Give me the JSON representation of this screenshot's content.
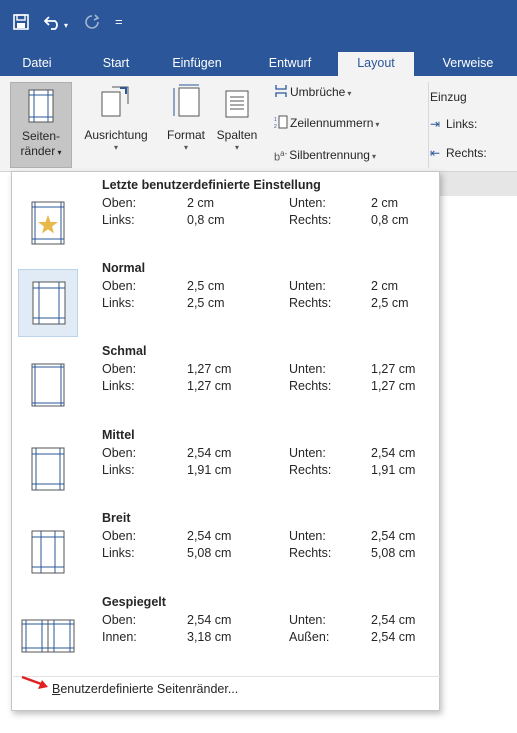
{
  "qat": {
    "save": "save-icon",
    "undo": "undo-icon",
    "redo": "redo-icon",
    "customize": "="
  },
  "tabs": [
    "Datei",
    "Start",
    "Einfügen",
    "Entwurf",
    "Layout",
    "Verweise"
  ],
  "active_tab": "Layout",
  "ribbon": {
    "margins_label_1": "Seiten-",
    "margins_label_2": "ränder",
    "orientation": "Ausrichtung",
    "size": "Format",
    "columns": "Spalten",
    "breaks": "Umbrüche",
    "line_numbers": "Zeilennummern",
    "hyphenation": "Silbentrennung",
    "indent": "Einzug",
    "indent_left": "Links:",
    "indent_right": "Rechts:",
    "accent": "#2b579a"
  },
  "margins_menu": {
    "items": [
      {
        "title": "Letzte benutzerdefinierte Einstellung",
        "l1": "Oben:",
        "v1": "2 cm",
        "l2": "Unten:",
        "v2": "2 cm",
        "l3": "Links:",
        "v3": "0,8 cm",
        "l4": "Rechts:",
        "v4": "0,8 cm",
        "icon": "custom-margins-star-icon"
      },
      {
        "title": "Normal",
        "l1": "Oben:",
        "v1": "2,5 cm",
        "l2": "Unten:",
        "v2": "2 cm",
        "l3": "Links:",
        "v3": "2,5 cm",
        "l4": "Rechts:",
        "v4": "2,5 cm",
        "icon": "normal-margins-icon"
      },
      {
        "title": "Schmal",
        "l1": "Oben:",
        "v1": "1,27 cm",
        "l2": "Unten:",
        "v2": "1,27 cm",
        "l3": "Links:",
        "v3": "1,27 cm",
        "l4": "Rechts:",
        "v4": "1,27 cm",
        "icon": "narrow-margins-icon"
      },
      {
        "title": "Mittel",
        "l1": "Oben:",
        "v1": "2,54 cm",
        "l2": "Unten:",
        "v2": "2,54 cm",
        "l3": "Links:",
        "v3": "1,91 cm",
        "l4": "Rechts:",
        "v4": "1,91 cm",
        "icon": "moderate-margins-icon"
      },
      {
        "title": "Breit",
        "l1": "Oben:",
        "v1": "2,54 cm",
        "l2": "Unten:",
        "v2": "2,54 cm",
        "l3": "Links:",
        "v3": "5,08 cm",
        "l4": "Rechts:",
        "v4": "5,08 cm",
        "icon": "wide-margins-icon"
      },
      {
        "title": "Gespiegelt",
        "l1": "Oben:",
        "v1": "2,54 cm",
        "l2": "Unten:",
        "v2": "2,54 cm",
        "l3": "Innen:",
        "v3": "3,18 cm",
        "l4": "Außen:",
        "v4": "2,54 cm",
        "icon": "mirrored-margins-icon"
      }
    ],
    "custom_first_letter": "B",
    "custom_rest": "enutzerdefinierte Seitenränder..."
  }
}
